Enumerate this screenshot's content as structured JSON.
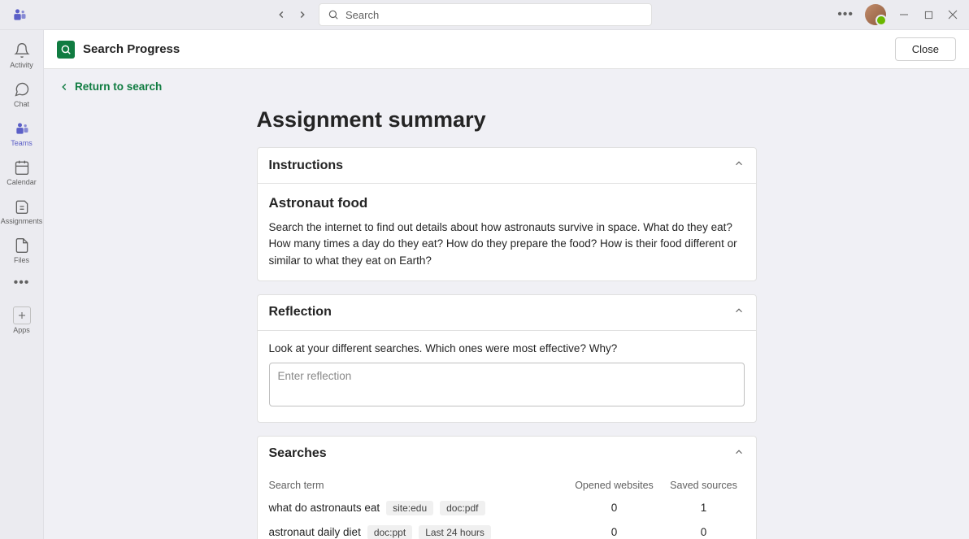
{
  "titlebar": {
    "search_placeholder": "Search"
  },
  "rail": {
    "activity": "Activity",
    "chat": "Chat",
    "teams": "Teams",
    "calendar": "Calendar",
    "assignments": "Assignments",
    "files": "Files",
    "apps": "Apps"
  },
  "appbar": {
    "title": "Search Progress",
    "close": "Close"
  },
  "back": "Return to search",
  "page_title": "Assignment summary",
  "instructions": {
    "heading": "Instructions",
    "title": "Astronaut food",
    "text": "Search the internet to find out details about how astronauts survive in space. What do they eat? How many times a day do they eat? How do they prepare the food? How is their food different or similar to what they eat on Earth?"
  },
  "reflection": {
    "heading": "Reflection",
    "prompt": "Look at your different searches. Which ones were most effective? Why?",
    "placeholder": "Enter reflection"
  },
  "searches": {
    "heading": "Searches",
    "col_term": "Search term",
    "col_open": "Opened websites",
    "col_saved": "Saved sources",
    "rows": [
      {
        "term": "what do astronauts eat",
        "tags": [
          "site:edu",
          "doc:pdf"
        ],
        "opened": "0",
        "saved": "1"
      },
      {
        "term": "astronaut daily diet",
        "tags": [
          "doc:ppt",
          "Last 24 hours"
        ],
        "opened": "0",
        "saved": "0"
      }
    ]
  }
}
